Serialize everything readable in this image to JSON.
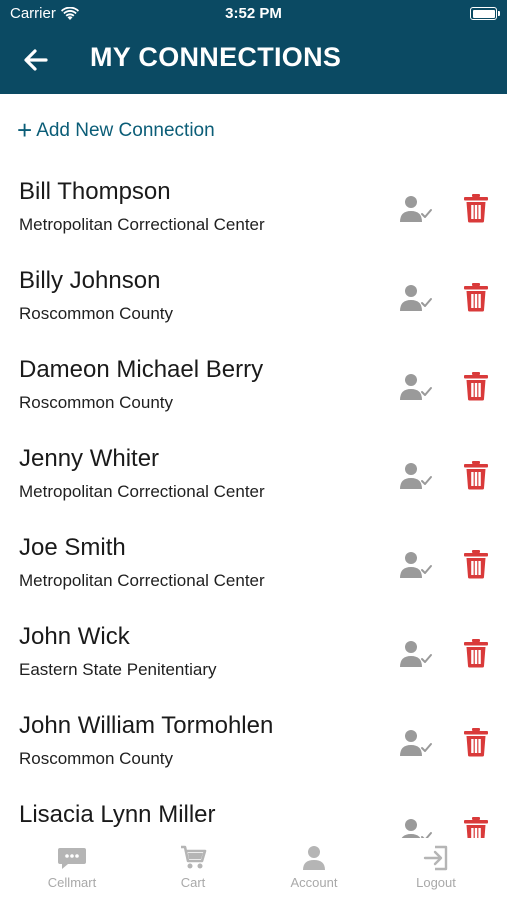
{
  "status_bar": {
    "carrier": "Carrier",
    "time": "3:52 PM"
  },
  "header": {
    "title": "MY CONNECTIONS",
    "back_icon": "arrow-left-icon"
  },
  "actions": {
    "add_label": "Add New Connection",
    "add_icon": "plus-icon"
  },
  "connections": [
    {
      "name": "Bill Thompson",
      "facility": "Metropolitan Correctional Center"
    },
    {
      "name": "Billy Johnson",
      "facility": "Roscommon County"
    },
    {
      "name": "Dameon Michael Berry",
      "facility": "Roscommon County"
    },
    {
      "name": "Jenny Whiter",
      "facility": "Metropolitan Correctional Center"
    },
    {
      "name": "Joe Smith",
      "facility": "Metropolitan Correctional Center"
    },
    {
      "name": "John Wick",
      "facility": "Eastern State Penitentiary"
    },
    {
      "name": "John William Tormohlen",
      "facility": "Roscommon County"
    },
    {
      "name": "Lisacia Lynn Miller",
      "facility": ""
    }
  ],
  "tabs": [
    {
      "label": "Cellmart",
      "icon": "chat-bubble-icon"
    },
    {
      "label": "Cart",
      "icon": "cart-icon"
    },
    {
      "label": "Account",
      "icon": "person-icon"
    },
    {
      "label": "Logout",
      "icon": "logout-icon"
    }
  ],
  "colors": {
    "header_bg": "#0b4a63",
    "accent": "#0b5d77",
    "delete": "#d93a3a",
    "muted_icon": "#9a9a9a",
    "tab_inactive": "#a9a9a9"
  }
}
